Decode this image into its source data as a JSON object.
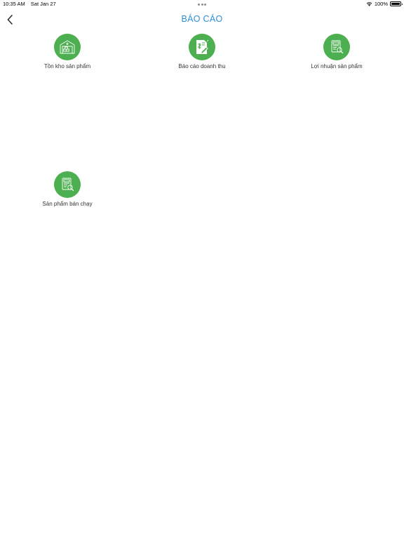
{
  "status_bar": {
    "time": "10:35 AM",
    "date": "Sat Jan 27",
    "battery": "100%"
  },
  "nav": {
    "title": "BÁO CÁO",
    "back_icon": "chevron-left-icon"
  },
  "colors": {
    "accent": "#2b8fd6",
    "icon_bg": "#4caf50"
  },
  "reports": [
    {
      "label": "Tồn kho sản phẩm",
      "icon": "warehouse-icon"
    },
    {
      "label": "Báo cáo doanh thu",
      "icon": "revenue-report-icon"
    },
    {
      "label": "Lợi nhuận sản phẩm",
      "icon": "profit-report-icon"
    },
    {
      "label": "Sản phẩm bán chạy",
      "icon": "best-seller-icon"
    }
  ]
}
